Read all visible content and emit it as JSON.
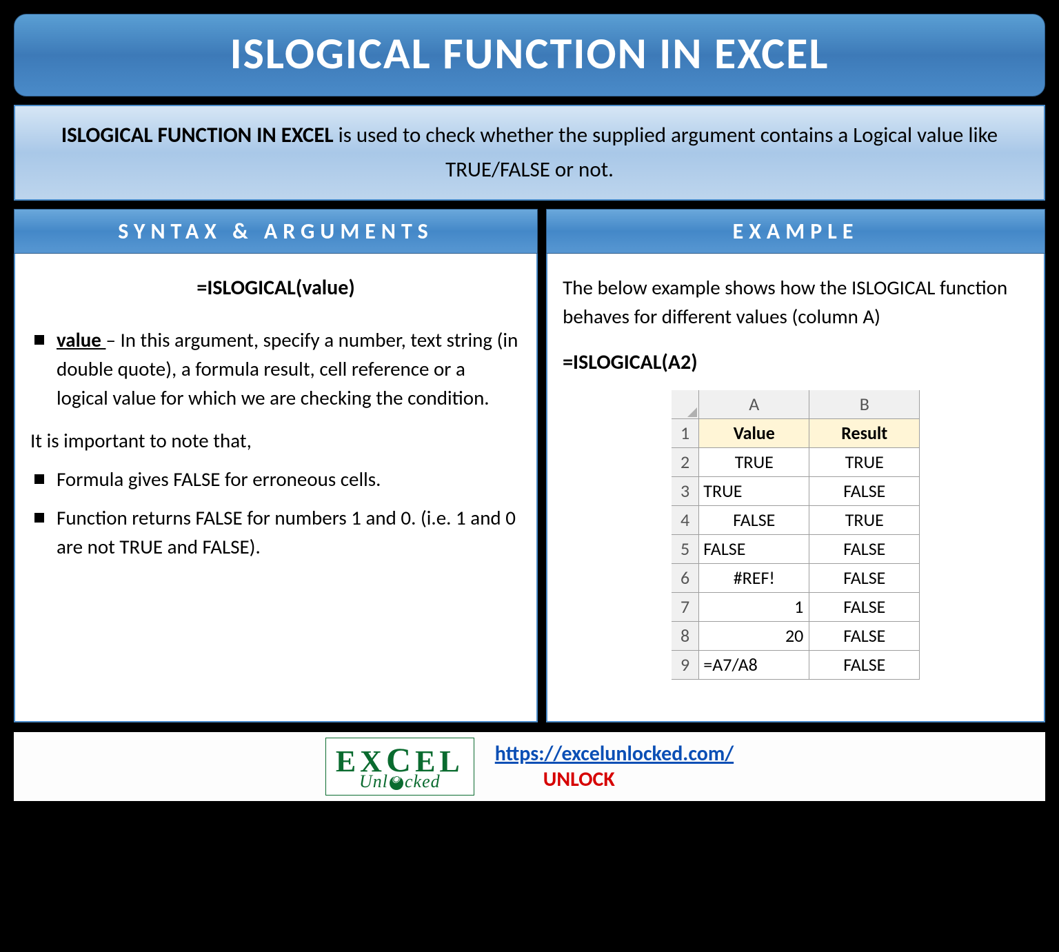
{
  "title": "ISLOGICAL FUNCTION IN EXCEL",
  "intro": {
    "bold": "ISLOGICAL FUNCTION IN EXCEL",
    "rest": " is used to check whether the supplied argument contains a Logical value like TRUE/FALSE or not."
  },
  "syntax": {
    "header": "SYNTAX & ARGUMENTS",
    "formula": "=ISLOGICAL(value)",
    "arg_name": "value ",
    "arg_desc": "– In this argument, specify a number, text string (in double quote), a formula result, cell reference or a logical value for which we are checking the condition.",
    "note_lead": "It is important to note that,",
    "note1": "Formula gives FALSE for erroneous cells.",
    "note2": "Function returns FALSE for numbers 1 and 0. (i.e. 1 and 0 are not TRUE and FALSE)."
  },
  "example": {
    "header": "EXAMPLE",
    "intro": "The below example shows how the ISLOGICAL function behaves for different values (column A)",
    "formula": "=ISLOGICAL(A2)",
    "col_a": "A",
    "col_b": "B",
    "hdr_value": "Value",
    "hdr_result": "Result",
    "rows": [
      {
        "n": "1",
        "a": "Value",
        "b": "Result"
      },
      {
        "n": "2",
        "a": "TRUE",
        "b": "TRUE"
      },
      {
        "n": "3",
        "a": "TRUE",
        "b": "FALSE"
      },
      {
        "n": "4",
        "a": "FALSE",
        "b": "TRUE"
      },
      {
        "n": "5",
        "a": "FALSE",
        "b": "FALSE"
      },
      {
        "n": "6",
        "a": "#REF!",
        "b": "FALSE"
      },
      {
        "n": "7",
        "a": "1",
        "b": "FALSE"
      },
      {
        "n": "8",
        "a": "20",
        "b": "FALSE"
      },
      {
        "n": "9",
        "a": "=A7/A8",
        "b": "FALSE"
      }
    ]
  },
  "footer": {
    "logo_top": "EX  EL",
    "logo_bot": "Unl   cked",
    "url": "https://excelunlocked.com/",
    "unlock": "UNLOCK"
  }
}
